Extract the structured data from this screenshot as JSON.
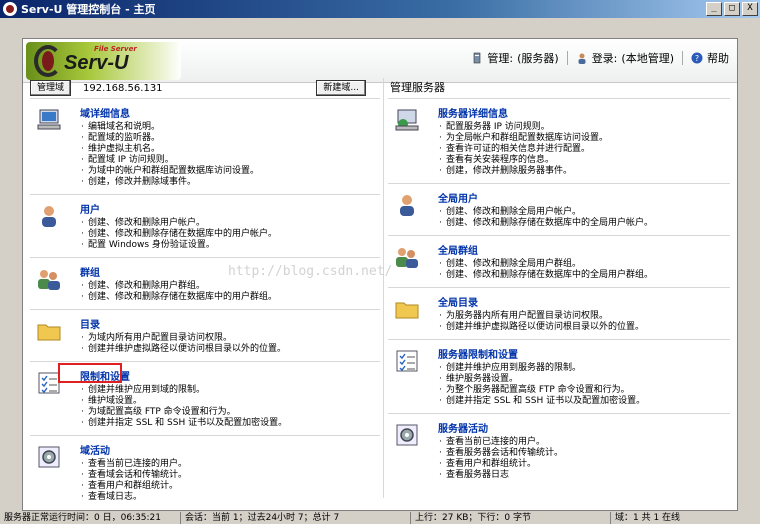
{
  "window": {
    "title": "Serv-U 管理控制台 - 主页",
    "buttons": [
      "_",
      "□",
      "X"
    ]
  },
  "header": {
    "logo_small": "File Server",
    "logo_name": "Serv-U",
    "links": [
      {
        "label": "管理:",
        "value": "(服务器)"
      },
      {
        "label": "登录:",
        "value": "(本地管理)"
      },
      {
        "label": "帮助"
      }
    ]
  },
  "left": {
    "domain_button": "管理域",
    "domain_ip": "192.168.56.131",
    "new_domain_button": "新建域...",
    "sections": [
      {
        "title": "域详细信息",
        "items": [
          "编辑域名和说明。",
          "配置域的监听器。",
          "维护虚拟主机名。",
          "配置域 IP 访问规则。",
          "为域中的帐户和群组配置数据库访问设置。",
          "创建，修改并删除域事件。"
        ]
      },
      {
        "title": "用户",
        "items": [
          "创建、修改和删除用户帐户。",
          "创建、修改和删除存储在数据库中的用户帐户。",
          "配置 Windows 身份验证设置。"
        ]
      },
      {
        "title": "群组",
        "items": [
          "创建、修改和删除用户群组。",
          "创建、修改和删除存储在数据库中的用户群组。"
        ]
      },
      {
        "title": "目录",
        "items": [
          "为域内所有用户配置目录访问权限。",
          "创建并维护虚拟路径以便访问根目录以外的位置。"
        ]
      },
      {
        "title": "限制和设置",
        "items": [
          "创建并维护应用到域的限制。",
          "维护域设置。",
          "为域配置高级 FTP 命令设置和行为。",
          "创建并指定 SSL 和 SSH 证书以及配置加密设置。"
        ]
      },
      {
        "title": "域活动",
        "items": [
          "查看当前已连接的用户。",
          "查看域会话和传输统计。",
          "查看用户和群组统计。",
          "查看域日志。"
        ]
      }
    ]
  },
  "right": {
    "heading": "管理服务器",
    "sections": [
      {
        "title": "服务器详细信息",
        "items": [
          "配置服务器 IP 访问规则。",
          "为全局帐户和群组配置数据库访问设置。",
          "查看许可证的相关信息并进行配置。",
          "查看有关安装程序的信息。",
          "创建，修改并删除服务器事件。"
        ]
      },
      {
        "title": "全局用户",
        "items": [
          "创建、修改和删除全局用户帐户。",
          "创建、修改和删除存储在数据库中的全局用户帐户。"
        ]
      },
      {
        "title": "全局群组",
        "items": [
          "创建、修改和删除全局用户群组。",
          "创建、修改和删除存储在数据库中的全局用户群组。"
        ]
      },
      {
        "title": "全局目录",
        "items": [
          "为服务器内所有用户配置目录访问权限。",
          "创建并维护虚拟路径以便访问根目录以外的位置。"
        ]
      },
      {
        "title": "服务器限制和设置",
        "items": [
          "创建并维护应用到服务器的限制。",
          "维护服务器设置。",
          "为整个服务器配置高级 FTP 命令设置和行为。",
          "创建并指定 SSL 和 SSH 证书以及配置加密设置。"
        ]
      },
      {
        "title": "服务器活动",
        "items": [
          "查看当前已连接的用户。",
          "查看服务器会话和传输统计。",
          "查看用户和群组统计。",
          "查看服务器日志"
        ]
      }
    ]
  },
  "watermark": "http://blog.csdn.net/",
  "statusbar": [
    "服务器正常运行时间：0 日，06:35:21",
    "会话：当前 1；过去24小时 7；总计 7",
    "上行：27 KB；下行：0 字节",
    "域：1 共 1 在线"
  ]
}
